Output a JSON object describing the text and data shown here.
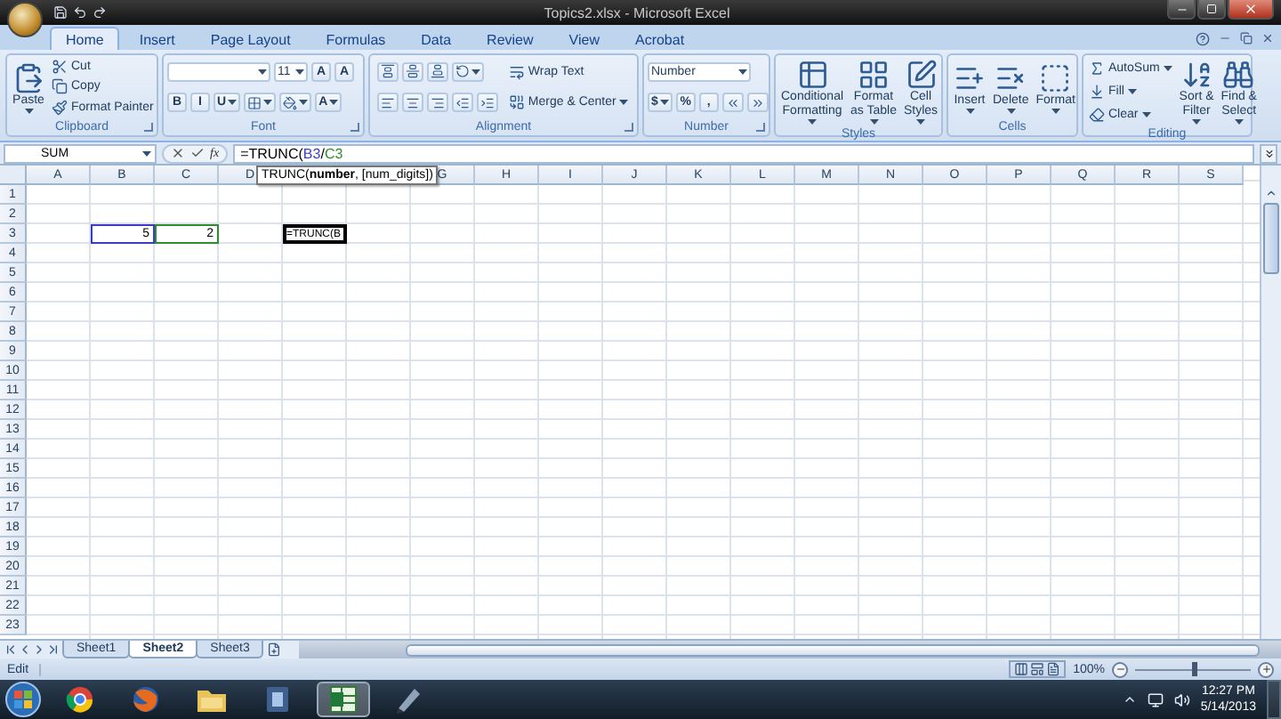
{
  "window": {
    "title": "Topics2.xlsx - Microsoft Excel"
  },
  "ribbon": {
    "tabs": [
      {
        "label": "Home",
        "selected": true
      },
      {
        "label": "Insert",
        "selected": false
      },
      {
        "label": "Page Layout",
        "selected": false
      },
      {
        "label": "Formulas",
        "selected": false
      },
      {
        "label": "Data",
        "selected": false
      },
      {
        "label": "Review",
        "selected": false
      },
      {
        "label": "View",
        "selected": false
      },
      {
        "label": "Acrobat",
        "selected": false
      }
    ],
    "groups": [
      {
        "label": "Clipboard",
        "launcher": true,
        "columns": [
          [
            {
              "kind": "large",
              "lines": [
                "Paste"
              ],
              "dropdown": true
            }
          ],
          [
            {
              "kind": "small",
              "label": "Cut"
            },
            {
              "kind": "small",
              "label": "Copy"
            },
            {
              "kind": "small",
              "label": "Format Painter"
            }
          ]
        ]
      },
      {
        "label": "Font",
        "launcher": true,
        "columns": [
          [
            {
              "kind": "toolbar",
              "buttons": [
                {
                  "kind": "wide-field",
                  "dropdown": true
                },
                {
                  "kind": "field",
                  "text": "11",
                  "dropdown": true
                },
                {
                  "kind": "glyph",
                  "text": "A"
                },
                {
                  "kind": "glyph",
                  "text": "A"
                }
              ]
            },
            {
              "kind": "toolbar",
              "buttons": [
                {
                  "kind": "glyph",
                  "text": "B"
                },
                {
                  "kind": "glyph",
                  "text": "I"
                },
                {
                  "kind": "glyph",
                  "text": "U",
                  "dropdown": true
                },
                {
                  "kind": "icon",
                  "dropdown": true
                },
                {
                  "kind": "icon",
                  "dropdown": true
                },
                {
                  "kind": "glyph",
                  "text": "A",
                  "dropdown": true
                }
              ]
            }
          ]
        ]
      },
      {
        "label": "Alignment",
        "launcher": true,
        "columns": [
          [
            {
              "kind": "toolbar",
              "buttons": [
                {
                  "kind": "icon"
                },
                {
                  "kind": "icon"
                },
                {
                  "kind": "icon"
                },
                {
                  "kind": "icon",
                  "dropdown": true
                }
              ]
            },
            {
              "kind": "toolbar",
              "buttons": [
                {
                  "kind": "icon"
                },
                {
                  "kind": "icon"
                },
                {
                  "kind": "icon"
                },
                {
                  "kind": "icon"
                },
                {
                  "kind": "icon"
                }
              ]
            }
          ],
          [
            {
              "kind": "small",
              "label": "Wrap Text"
            },
            {
              "kind": "small",
              "label": "Merge & Center",
              "dropdown": true
            }
          ]
        ]
      },
      {
        "label": "Number",
        "launcher": true,
        "columns": [
          [
            {
              "kind": "toolbar",
              "buttons": [
                {
                  "kind": "wide-field",
                  "text": "Number",
                  "dropdown": true
                }
              ]
            },
            {
              "kind": "toolbar",
              "buttons": [
                {
                  "kind": "glyph",
                  "text": "$",
                  "dropdown": true
                },
                {
                  "kind": "glyph",
                  "text": "%"
                },
                {
                  "kind": "glyph",
                  "text": ","
                },
                {
                  "kind": "icon"
                },
                {
                  "kind": "icon"
                }
              ]
            }
          ]
        ]
      },
      {
        "label": "Styles",
        "launcher": false,
        "columns": [
          [
            {
              "kind": "large",
              "lines": [
                "Conditional",
                "Formatting"
              ],
              "dropdown": true
            }
          ],
          [
            {
              "kind": "large",
              "lines": [
                "Format",
                "as Table"
              ],
              "dropdown": true
            }
          ],
          [
            {
              "kind": "large",
              "lines": [
                "Cell",
                "Styles"
              ],
              "dropdown": true
            }
          ]
        ]
      },
      {
        "label": "Cells",
        "launcher": false,
        "columns": [
          [
            {
              "kind": "large",
              "lines": [
                "Insert"
              ],
              "dropdown": true
            }
          ],
          [
            {
              "kind": "large",
              "lines": [
                "Delete"
              ],
              "dropdown": true
            }
          ],
          [
            {
              "kind": "large",
              "lines": [
                "Format"
              ],
              "dropdown": true
            }
          ]
        ]
      },
      {
        "label": "Editing",
        "launcher": false,
        "columns": [
          [
            {
              "kind": "small",
              "label": "AutoSum",
              "dropdown": true
            },
            {
              "kind": "small",
              "label": "Fill",
              "dropdown": true
            },
            {
              "kind": "small",
              "label": "Clear",
              "dropdown": true
            }
          ],
          [
            {
              "kind": "large",
              "lines": [
                "Sort &",
                "Filter"
              ],
              "dropdown": true
            }
          ],
          [
            {
              "kind": "large",
              "lines": [
                "Find &",
                "Select"
              ],
              "dropdown": true
            }
          ]
        ]
      }
    ]
  },
  "formula_bar": {
    "name_box": "SUM",
    "function_button": "fx",
    "formula_parts": [
      {
        "text": "=TRUNC("
      },
      {
        "text": "B3",
        "color": "#3b3bc4"
      },
      {
        "text": "/"
      },
      {
        "text": "C3",
        "color": "#2e8b2e"
      }
    ]
  },
  "tooltip": "TRUNC(**number**, [num_digits])",
  "grid": {
    "columns": [
      "A",
      "B",
      "C",
      "D",
      null,
      null,
      "G",
      "H",
      "I",
      "J",
      "K",
      "L",
      "M",
      "N",
      "O",
      "P",
      "Q",
      "R",
      "S"
    ],
    "rows": [
      {
        "label": "1"
      },
      {
        "label": "2"
      },
      {
        "label": "3",
        "cells": [
          null,
          {
            "value": "5",
            "kind": "reference",
            "color": "#3b3bc4"
          },
          {
            "value": "2",
            "kind": "reference",
            "color": "#2e8b2e"
          },
          null,
          {
            "value": "=TRUNC(B",
            "kind": "editing"
          }
        ]
      },
      {
        "label": "4"
      },
      {
        "label": "5"
      },
      {
        "label": "6"
      },
      {
        "label": "7"
      },
      {
        "label": "8"
      },
      {
        "label": "9"
      },
      {
        "label": "10"
      },
      {
        "label": "11"
      },
      {
        "label": "12"
      },
      {
        "label": "13"
      },
      {
        "label": "14"
      },
      {
        "label": "15"
      },
      {
        "label": "16"
      },
      {
        "label": "17"
      },
      {
        "label": "18"
      },
      {
        "label": "19"
      },
      {
        "label": "20"
      },
      {
        "label": "21"
      },
      {
        "label": "22"
      },
      {
        "label": "23"
      }
    ]
  },
  "sheet_tabs": [
    {
      "label": "Sheet1",
      "selected": false
    },
    {
      "label": "Sheet2",
      "selected": true
    },
    {
      "label": "Sheet3",
      "selected": false
    }
  ],
  "status_bar": {
    "mode": "Edit",
    "zoom": "100%",
    "zoom_slider": {
      "level": 0.5
    }
  },
  "taskbar": {
    "apps": [
      {
        "selected": false
      },
      {
        "selected": false
      },
      {
        "selected": false
      },
      {
        "selected": false
      },
      {
        "selected": true
      },
      {
        "selected": false
      }
    ],
    "time": "12:27 PM",
    "date": "5/14/2013"
  }
}
